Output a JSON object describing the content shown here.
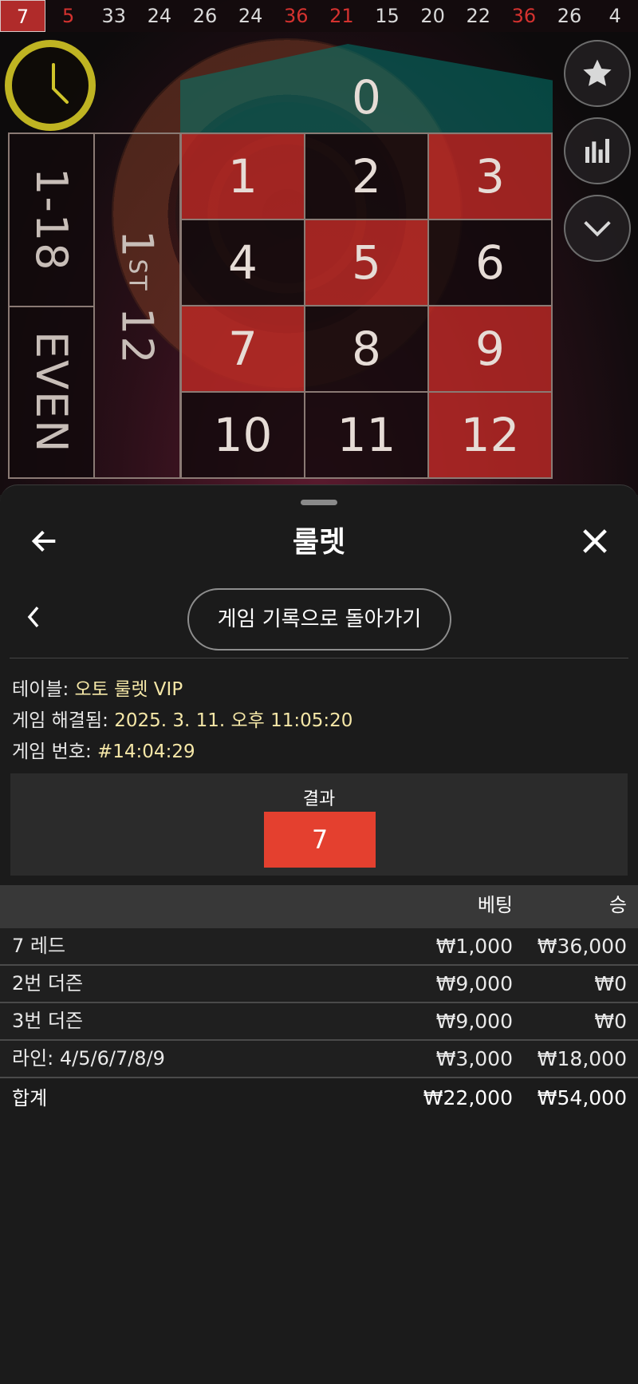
{
  "history": {
    "numbers": [
      "7",
      "5",
      "33",
      "24",
      "26",
      "24",
      "36",
      "21",
      "15",
      "20",
      "22",
      "36",
      "26",
      "4"
    ],
    "colors": [
      "red",
      "red",
      "black",
      "black",
      "black",
      "black",
      "red",
      "red",
      "black",
      "black",
      "black",
      "red",
      "black",
      "black"
    ]
  },
  "board": {
    "zero": "0",
    "row1": [
      "1",
      "2",
      "3"
    ],
    "row2": [
      "4",
      "5",
      "6"
    ],
    "row3": [
      "7",
      "8",
      "9"
    ],
    "row4": [
      "10",
      "11",
      "12"
    ],
    "outside_1_18": "1-18",
    "outside_even": "EVEN",
    "dozen_number": "1",
    "dozen_suffix": "ST",
    "dozen_value": "12"
  },
  "sheet": {
    "title": "룰렛",
    "back_to_history": "게임 기록으로 돌아가기",
    "table_label": "테이블:",
    "table_value": "오토 룰렛 VIP",
    "resolved_label": "게임 해결됨:",
    "resolved_value": "2025. 3. 11. 오후 11:05:20",
    "game_no_label": "게임 번호:",
    "game_no_value": "#14:04:29",
    "result_label": "결과",
    "result_value": "7",
    "col_bet": "베팅",
    "col_win": "승",
    "rows": [
      {
        "name": "7 레드",
        "bet": "₩1,000",
        "win": "₩36,000"
      },
      {
        "name": "2번 더즌",
        "bet": "₩9,000",
        "win": "₩0"
      },
      {
        "name": "3번 더즌",
        "bet": "₩9,000",
        "win": "₩0"
      },
      {
        "name": "라인: 4/5/6/7/8/9",
        "bet": "₩3,000",
        "win": "₩18,000"
      }
    ],
    "total": {
      "name": "합계",
      "bet": "₩22,000",
      "win": "₩54,000"
    }
  },
  "colors": {
    "accent_red": "#e4402f",
    "timer_yellow": "#bfb422",
    "value_yellow": "#f5e7a7"
  }
}
